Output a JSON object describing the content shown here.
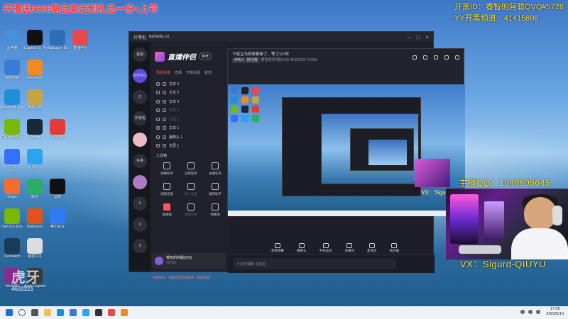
{
  "overlay": {
    "top_left": "开播送6666萌品美定制礼品一份+上号",
    "top_right_line1": "开黑ID：睿智的阿聪QVQ#5726",
    "top_right_line2": "YY开黑频道：41415898",
    "qq": "主播QQ：1046805645",
    "vx": "VX：Sigurd-QIUYU",
    "small": "VX：Sigu",
    "watermark_line1": "虎牙",
    "watermark_line2": "4632221"
  },
  "desktop_icons": [
    {
      "name": "此电脑",
      "icon": "computer-icon",
      "color": "#4a90d9"
    },
    {
      "name": "Logitech G HUB",
      "icon": "ghub-icon",
      "color": "#111111"
    },
    {
      "name": "Wallpaper Engine",
      "icon": "wallpaper-icon",
      "color": "#2f6db5"
    },
    {
      "name": "直播伴侣",
      "icon": "live-icon",
      "color": "#e84a4a"
    },
    {
      "name": "控制面板",
      "icon": "control-panel-icon",
      "color": "#3a7bd5"
    },
    {
      "name": "Overwatch",
      "icon": "overwatch-icon",
      "color": "#f08a24"
    },
    {
      "name": "",
      "icon": "",
      "color": "transparent"
    },
    {
      "name": "",
      "icon": "",
      "color": "transparent"
    },
    {
      "name": "Microsoft Edge",
      "icon": "edge-icon",
      "color": "#1f8fd6"
    },
    {
      "name": "英雄联盟",
      "icon": "lol-icon",
      "color": "#c7a348"
    },
    {
      "name": "",
      "icon": "",
      "color": "transparent"
    },
    {
      "name": "",
      "icon": "",
      "color": "transparent"
    },
    {
      "name": "GeForce Experience",
      "icon": "nvidia-icon",
      "color": "#76b900"
    },
    {
      "name": "Steam",
      "icon": "steam-icon",
      "color": "#1b2838"
    },
    {
      "name": "网易UU",
      "icon": "uu-icon",
      "color": "#e23b3b"
    },
    {
      "name": "",
      "icon": "",
      "color": "transparent"
    },
    {
      "name": "飞书",
      "icon": "feishu-icon",
      "color": "#3370ff"
    },
    {
      "name": "QQ",
      "icon": "qq-icon",
      "color": "#2aa3f0"
    },
    {
      "name": "",
      "icon": "",
      "color": "transparent"
    },
    {
      "name": "",
      "icon": "",
      "color": "transparent"
    },
    {
      "name": "Origin",
      "icon": "origin-icon",
      "color": "#f56c2d"
    },
    {
      "name": "微信",
      "icon": "wechat-icon",
      "color": "#2aae67"
    },
    {
      "name": "剪映",
      "icon": "capcut-icon",
      "color": "#111111"
    },
    {
      "name": "",
      "icon": "",
      "color": "transparent"
    },
    {
      "name": "GeForce Experience",
      "icon": "nvidia-icon",
      "color": "#76b900"
    },
    {
      "name": "Wallpaper",
      "icon": "wallpaper-icon",
      "color": "#e0531c"
    },
    {
      "name": "腾讯会议",
      "icon": "meeting-icon",
      "color": "#2f7bf6"
    },
    {
      "name": "",
      "icon": "",
      "color": "transparent"
    },
    {
      "name": "Overwatch",
      "icon": "overwatch-icon",
      "color": "#1b3a5a"
    },
    {
      "name": "新建文本",
      "icon": "file-icon",
      "color": "#dcdcdc"
    },
    {
      "name": "",
      "icon": "",
      "color": "transparent"
    },
    {
      "name": "",
      "icon": "",
      "color": "transparent"
    },
    {
      "name": "WinRAR",
      "icon": "winrar-icon",
      "color": "#8a2a8a"
    },
    {
      "name": "Apex Legends",
      "icon": "apex-icon",
      "color": "#3a3a3a"
    },
    {
      "name": "",
      "icon": "",
      "color": "transparent"
    },
    {
      "name": "",
      "icon": "",
      "color": "transparent"
    }
  ],
  "main_window": {
    "title": "开黑啦",
    "url": "kaiheila.cn",
    "rail": [
      "客服",
      "创作中心",
      "Q",
      "开黑啦",
      "兑换",
      "0",
      "0",
      "0"
    ],
    "app_name": "直播伴侣",
    "badge": "推荐",
    "tabs": [
      "场景设置",
      "直播",
      "开播设置",
      "其他"
    ],
    "layers": [
      {
        "label": "文本 4",
        "dim": false
      },
      {
        "label": "文本 5",
        "dim": false
      },
      {
        "label": "文本 4",
        "dim": false
      },
      {
        "label": "文本 3",
        "dim": true
      },
      {
        "label": "文本 2",
        "dim": true
      },
      {
        "label": "文本 1",
        "dim": false
      },
      {
        "label": "摄像头 1",
        "dim": false
      },
      {
        "label": "全屏 1",
        "dim": false
      }
    ],
    "tools_heading": "工具箱",
    "tools": [
      {
        "label": "弹幕助手",
        "state": ""
      },
      {
        "label": "房管助手",
        "state": ""
      },
      {
        "label": "主播任务",
        "state": ""
      },
      {
        "label": "视频连麦",
        "state": ""
      },
      {
        "label": "多人连麦",
        "state": "dim"
      },
      {
        "label": "推荐助手",
        "state": ""
      },
      {
        "label": "直播插",
        "state": "red"
      },
      {
        "label": "虚拟形象",
        "state": "dim"
      },
      {
        "label": "弹幕墙",
        "state": ""
      }
    ],
    "notice": "礼物任务、明星有好友或进中...查看说明",
    "profile_name": "睿智的阿聪QVQ",
    "profile_id": "#5726",
    "toolbar": [
      "游戏弹幕",
      "摄像头",
      "手机投屏",
      "多媒体",
      "麦克风",
      "扬声器"
    ],
    "chat_placeholder": "# 文字弹幕 互动区",
    "stats": "帧率 60fps   丢帧 0%   CPU 13%   内存 42%"
  },
  "preview_window": {
    "title": "下班立马回来更新了，等了1小时",
    "subtitle": "睿智的阿聪QVQ  4632223",
    "tag": "APEX · 排位赛",
    "count": "76115"
  },
  "taskbar": {
    "time": "17:05",
    "date": "2022/5/13"
  }
}
